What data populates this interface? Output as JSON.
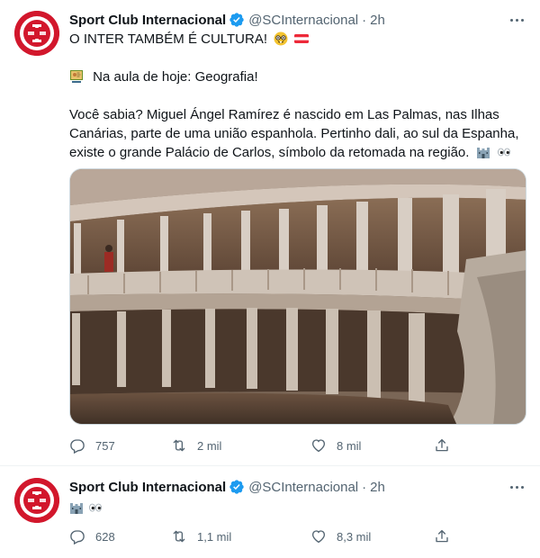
{
  "tweets": [
    {
      "author_name": "Sport Club Internacional",
      "handle": "@SCInternacional",
      "separator": "·",
      "time": "2h",
      "text_lines": [
        "O INTER TAMBÉM É CULTURA!",
        "",
        "Na aula de hoje: Geografia!",
        "",
        "Você sabia? Miguel Ángel Ramírez é nascido em Las Palmas, nas Ilhas",
        "Canárias, parte de uma união espanhola. Pertinho dali, ao sul da Espanha,",
        "existe o grande Palácio de Carlos, símbolo da retomada na região."
      ],
      "emojis": [
        "nerd-face-icon",
        "flag-austria-icon",
        "teacher-icon",
        "castle-icon",
        "eyes-icon"
      ],
      "media_description_icon": "palace-courtyard-photo",
      "replies": "757",
      "retweets": "2 mil",
      "likes": "8 mil"
    },
    {
      "author_name": "Sport Club Internacional",
      "handle": "@SCInternacional",
      "separator": "·",
      "time": "2h",
      "emojis": [
        "castle-icon",
        "eyes-icon"
      ],
      "replies": "628",
      "retweets": "1,1 mil",
      "likes": "8,3 mil"
    }
  ],
  "colors": {
    "brand_red": "#d2172c",
    "verified_blue": "#1d9bf0",
    "secondary_text": "#536471",
    "divider": "#eff3f4"
  }
}
